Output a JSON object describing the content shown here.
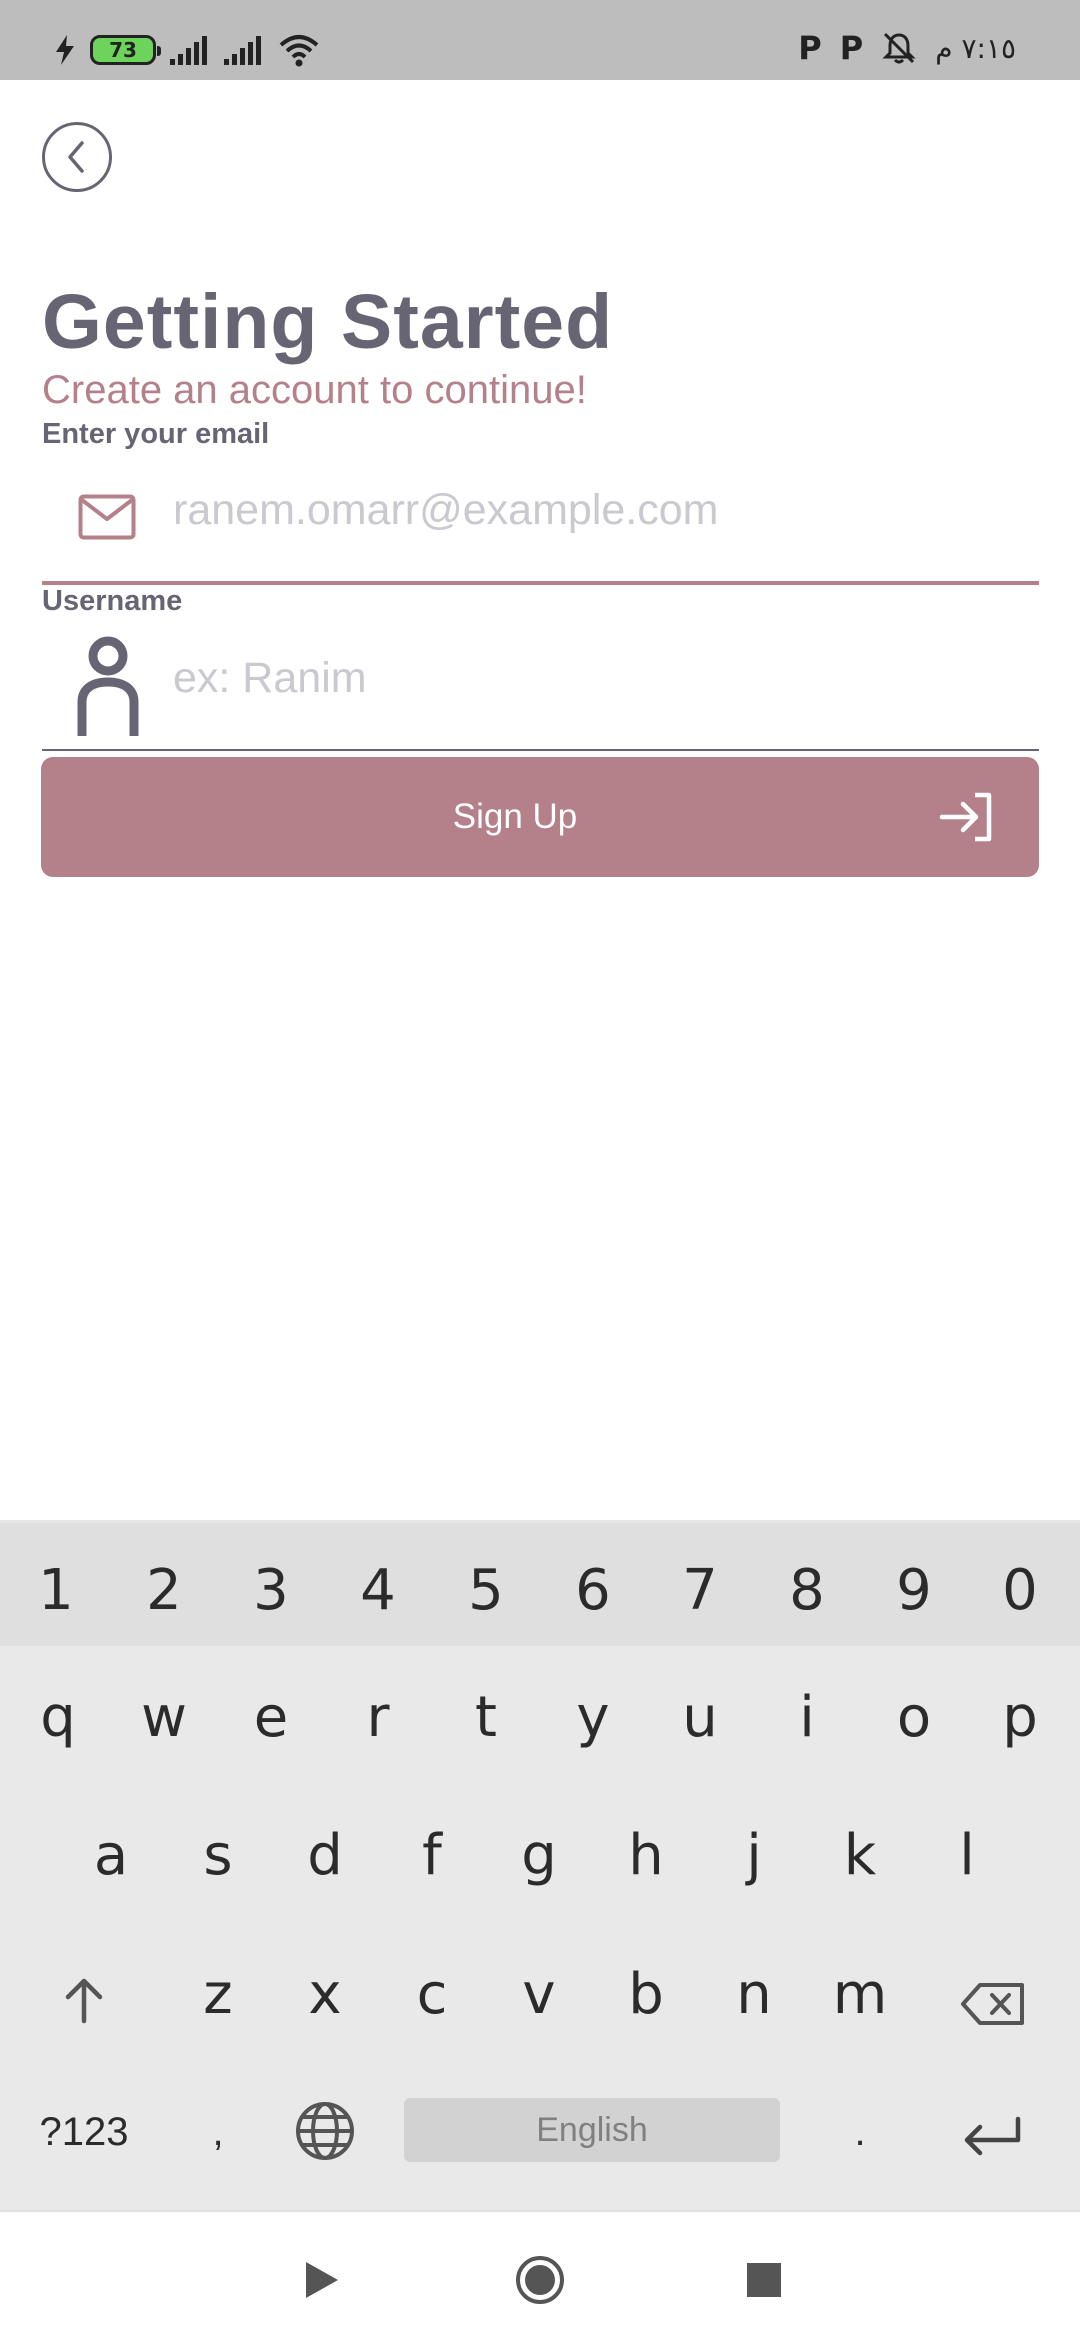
{
  "status_bar": {
    "battery_level": "73",
    "time": "٧:١٥ م",
    "notification_icons": [
      "p-icon",
      "p-icon",
      "muted-bell-icon"
    ]
  },
  "header": {
    "back_icon": "chevron-left-circle-icon"
  },
  "main": {
    "title": "Getting Started",
    "subtitle": "Create an account to continue!",
    "email": {
      "label": "Enter your email",
      "placeholder": "ranem.omarr@example.com",
      "icon": "mail-icon"
    },
    "username": {
      "label": "Username",
      "placeholder": "ex: Ranim",
      "icon": "person-icon"
    },
    "signup_button": {
      "label": "Sign Up",
      "icon": "login-arrow-icon"
    }
  },
  "keyboard": {
    "number_row": [
      "1",
      "2",
      "3",
      "4",
      "5",
      "6",
      "7",
      "8",
      "9",
      "0"
    ],
    "row1": [
      "q",
      "w",
      "e",
      "r",
      "t",
      "y",
      "u",
      "i",
      "o",
      "p"
    ],
    "row2": [
      "a",
      "s",
      "d",
      "f",
      "g",
      "h",
      "j",
      "k",
      "l"
    ],
    "row3": [
      "z",
      "x",
      "c",
      "v",
      "b",
      "n",
      "m"
    ],
    "symbols_label": "?123",
    "comma_label": ",",
    "space_label": "English",
    "period_label": "."
  },
  "nav_bar": {
    "icons": [
      "back-triangle-icon",
      "home-circle-icon",
      "recents-square-icon"
    ]
  },
  "colors": {
    "accent": "#b4808a",
    "text_primary": "#676574",
    "placeholder": "#c9c9cf",
    "status_bar_bg": "#bdbdbd",
    "keyboard_bg": "#e9e9e9"
  }
}
